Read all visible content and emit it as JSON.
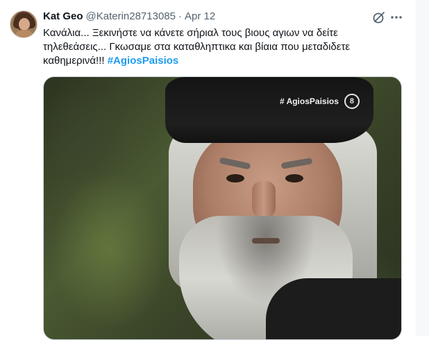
{
  "tweet": {
    "author": {
      "display_name": "Kat Geo",
      "handle": "@Katerin28713085",
      "separator": "·",
      "date": "Apr 12"
    },
    "actions": {
      "grok_icon": "grok-icon",
      "more_icon": "more-icon"
    },
    "text_lines": {
      "line1": "Κανάλια... Ξεκινήστε να κάνετε σήριαλ τους βιους αγιων να δείτε",
      "line2": "τηλεθεάσεις... Γκωσαμε στα καταθληπτικα και βίαια που μεταδιδετε",
      "line3": "καθημερινά!!!",
      "hashtag": "#AgiosPaisios"
    },
    "media": {
      "watermark_tag": "# AgiosPaisios",
      "watermark_badge": "8"
    }
  },
  "colors": {
    "accent": "#1d9bf0",
    "secondary_text": "#536471",
    "primary_text": "#0f1419"
  }
}
